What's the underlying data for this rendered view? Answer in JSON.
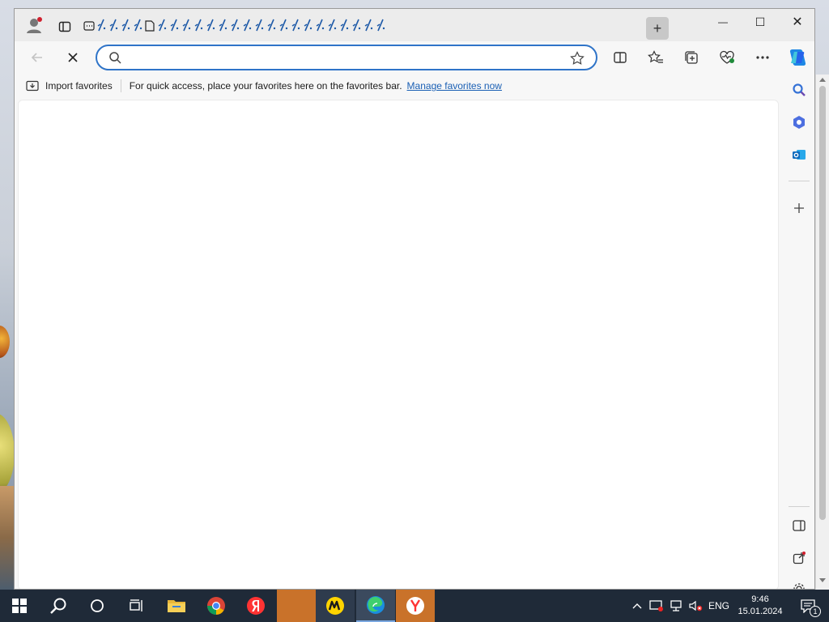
{
  "browser": {
    "window_controls": {
      "minimize": "—",
      "maximize": "☐",
      "close": "✕"
    },
    "tab_icon_count": 25,
    "new_tab_label": "+",
    "address": {
      "value": "",
      "placeholder": ""
    },
    "favorites_bar": {
      "import_label": "Import favorites",
      "hint": "For quick access, place your favorites here on the favorites bar.",
      "manage_link": "Manage favorites now"
    }
  },
  "taskbar": {
    "tray": {
      "language": "ENG",
      "time": "9:46",
      "date": "15.01.2024",
      "notification_count": "1"
    }
  },
  "colors": {
    "accent": "#2f74c8",
    "link": "#1a5fb4",
    "taskbar": "#1f2a38",
    "active_task": "#c9722a"
  }
}
